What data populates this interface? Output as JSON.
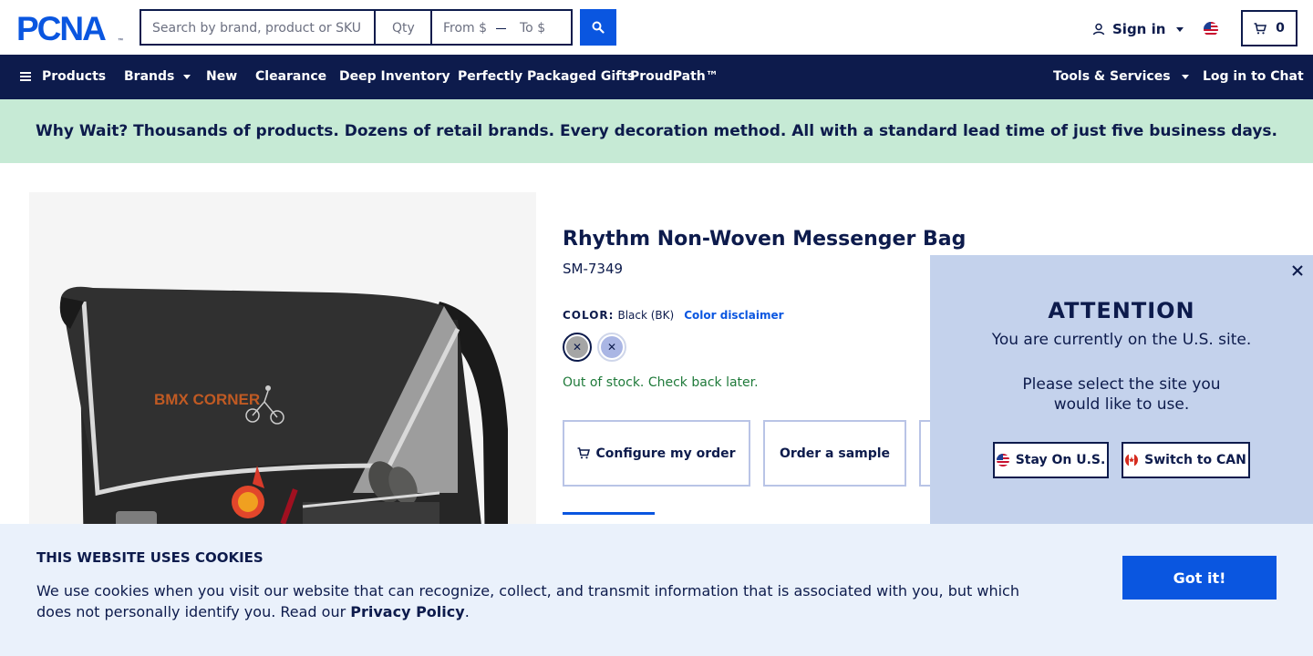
{
  "header": {
    "logo_text": "PCNA",
    "search_placeholder": "Search by brand, product or SKU",
    "qty_placeholder": "Qty",
    "price_from_placeholder": "From $",
    "price_to_placeholder": "To $",
    "signin_label": "Sign in",
    "cart_count": "0"
  },
  "nav": {
    "products": "Products",
    "brands": "Brands",
    "new": "New",
    "clearance": "Clearance",
    "deep_inventory": "Deep Inventory",
    "gifts": "Perfectly Packaged Gifts",
    "proudpath": "ProudPath™",
    "tools": "Tools & Services",
    "chat": "Log in to Chat"
  },
  "promo": {
    "text": "Why Wait? Thousands of products. Dozens of retail brands. Every decoration method. All with a standard lead time of just five business days."
  },
  "product": {
    "title": "Rhythm Non-Woven Messenger Bag",
    "sku": "SM-7349",
    "color_label": "COLOR:",
    "color_value": "Black (BK)",
    "color_disclaimer": "Color disclaimer",
    "stock_status": "Out of stock. Check back later.",
    "configure_label": "Configure my order",
    "sample_label": "Order a sample",
    "image_logo_text": "BMX CORNER"
  },
  "attention": {
    "title": "ATTENTION",
    "line1": "You are currently on the U.S. site.",
    "line2": "Please select the site you",
    "line3": "would like to use.",
    "stay_label": "Stay On U.S.",
    "switch_label": "Switch to CAN"
  },
  "cookie": {
    "title": "THIS WEBSITE USES COOKIES",
    "text": "We use cookies when you visit our website that can recognize, collect, and transmit information that is associated with you, but which does not personally identify you. Read our",
    "link": "Privacy Policy",
    "period": ".",
    "button": "Got it!"
  },
  "colors": {
    "navy": "#0d1b4c",
    "accent_blue": "#0a56e0",
    "promo_green": "#c6ead5",
    "popup_blue": "#c4d2ec",
    "cookie_bg": "#eaf1fb",
    "stock_green": "#1f7a3a"
  }
}
